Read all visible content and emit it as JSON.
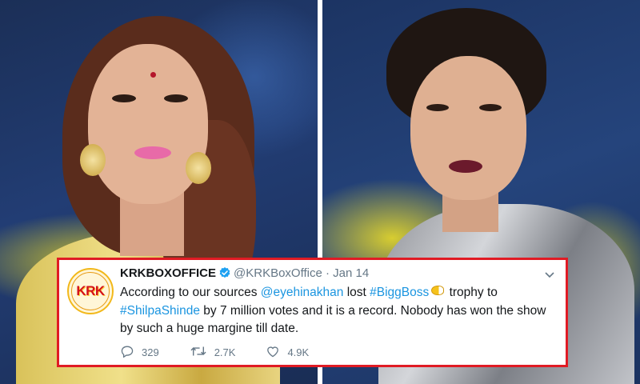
{
  "colors": {
    "highlight_border": "#e01b24",
    "link": "#1b95e0",
    "muted": "#657786",
    "verified": "#1da1f2"
  },
  "tweet": {
    "avatar_text": "KRK",
    "display_name": "KRKBOXOFFICE",
    "handle": "@KRKBoxOffice",
    "separator": "·",
    "date": "Jan 14",
    "menu_icon": "chevron-down-icon",
    "text": {
      "p1": "According to our sources ",
      "mention": "@eyehinakhan",
      "p2": " lost ",
      "hashtag1": "#BiggBoss",
      "p3": " trophy to",
      "hashtag2": "#ShilpaShinde",
      "p4": " by 7 million votes and it is a record. Nobody has won the show by such a huge margine till date."
    },
    "actions": {
      "replies": "329",
      "retweets": "2.7K",
      "likes": "4.9K"
    }
  }
}
